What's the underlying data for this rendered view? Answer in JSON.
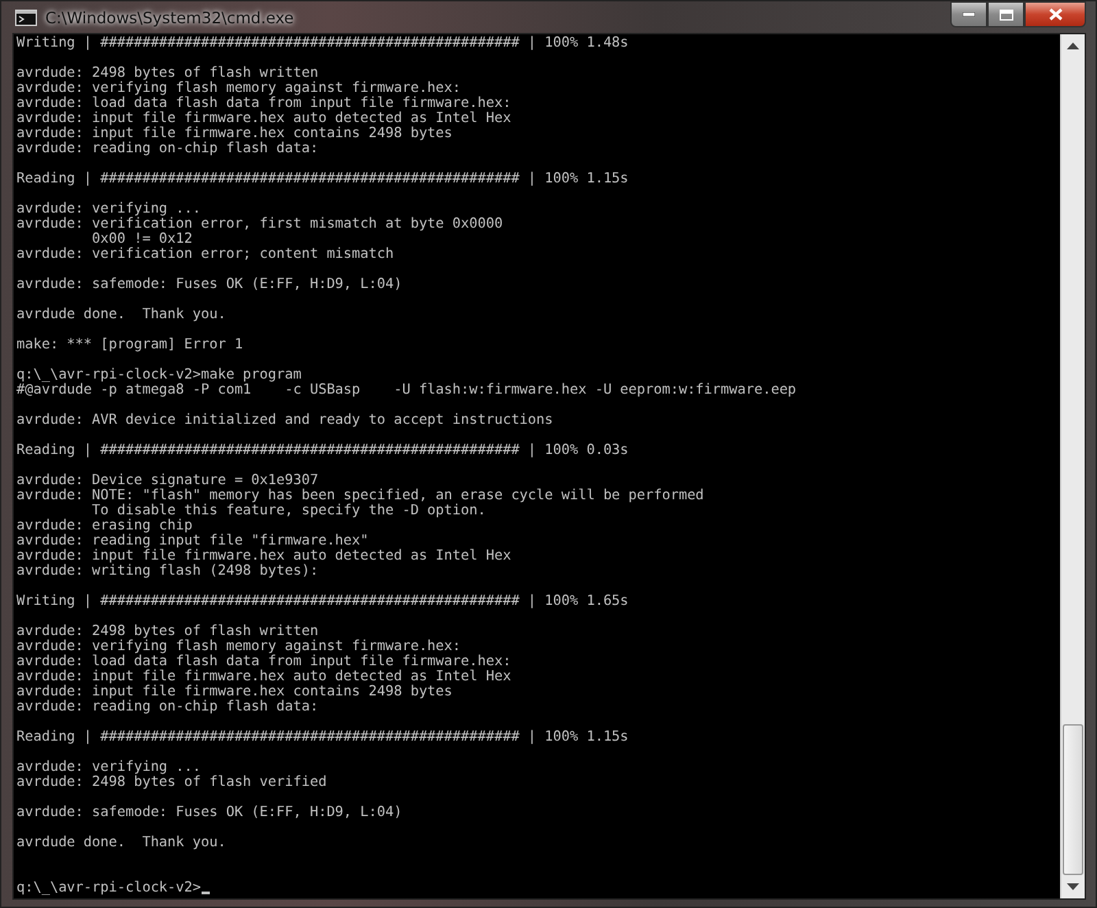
{
  "window": {
    "title": "C:\\Windows\\System32\\cmd.exe"
  },
  "blocks": [
    {
      "lines": [
        "Writing | ################################################## | 100% 1.48s"
      ]
    },
    {
      "lines": [
        "avrdude: 2498 bytes of flash written",
        "avrdude: verifying flash memory against firmware.hex:",
        "avrdude: load data flash data from input file firmware.hex:",
        "avrdude: input file firmware.hex auto detected as Intel Hex",
        "avrdude: input file firmware.hex contains 2498 bytes",
        "avrdude: reading on-chip flash data:"
      ]
    },
    {
      "lines": [
        "Reading | ################################################## | 100% 1.15s"
      ]
    },
    {
      "lines": [
        "avrdude: verifying ...",
        "avrdude: verification error, first mismatch at byte 0x0000",
        "         0x00 != 0x12",
        "avrdude: verification error; content mismatch"
      ]
    },
    {
      "lines": [
        "avrdude: safemode: Fuses OK (E:FF, H:D9, L:04)"
      ]
    },
    {
      "lines": [
        "avrdude done.  Thank you."
      ]
    },
    {
      "lines": [
        "make: *** [program] Error 1"
      ]
    },
    {
      "lines": [
        "q:\\_\\avr-rpi-clock-v2>make program",
        "#@avrdude -p atmega8 -P com1    -c USBasp    -U flash:w:firmware.hex -U eeprom:w:firmware.eep"
      ]
    },
    {
      "lines": [
        "avrdude: AVR device initialized and ready to accept instructions"
      ]
    },
    {
      "lines": [
        "Reading | ################################################## | 100% 0.03s"
      ]
    },
    {
      "lines": [
        "avrdude: Device signature = 0x1e9307",
        "avrdude: NOTE: \"flash\" memory has been specified, an erase cycle will be performed",
        "         To disable this feature, specify the -D option.",
        "avrdude: erasing chip",
        "avrdude: reading input file \"firmware.hex\"",
        "avrdude: input file firmware.hex auto detected as Intel Hex",
        "avrdude: writing flash (2498 bytes):"
      ]
    },
    {
      "lines": [
        "Writing | ################################################## | 100% 1.65s"
      ]
    },
    {
      "lines": [
        "avrdude: 2498 bytes of flash written",
        "avrdude: verifying flash memory against firmware.hex:",
        "avrdude: load data flash data from input file firmware.hex:",
        "avrdude: input file firmware.hex auto detected as Intel Hex",
        "avrdude: input file firmware.hex contains 2498 bytes",
        "avrdude: reading on-chip flash data:"
      ]
    },
    {
      "lines": [
        "Reading | ################################################## | 100% 1.15s"
      ]
    },
    {
      "lines": [
        "avrdude: verifying ...",
        "avrdude: 2498 bytes of flash verified"
      ]
    },
    {
      "lines": [
        "avrdude: safemode: Fuses OK (E:FF, H:D9, L:04)"
      ]
    },
    {
      "lines": [
        "avrdude done.  Thank you."
      ]
    }
  ],
  "prompt": {
    "text": "q:\\_\\avr-rpi-clock-v2>"
  }
}
